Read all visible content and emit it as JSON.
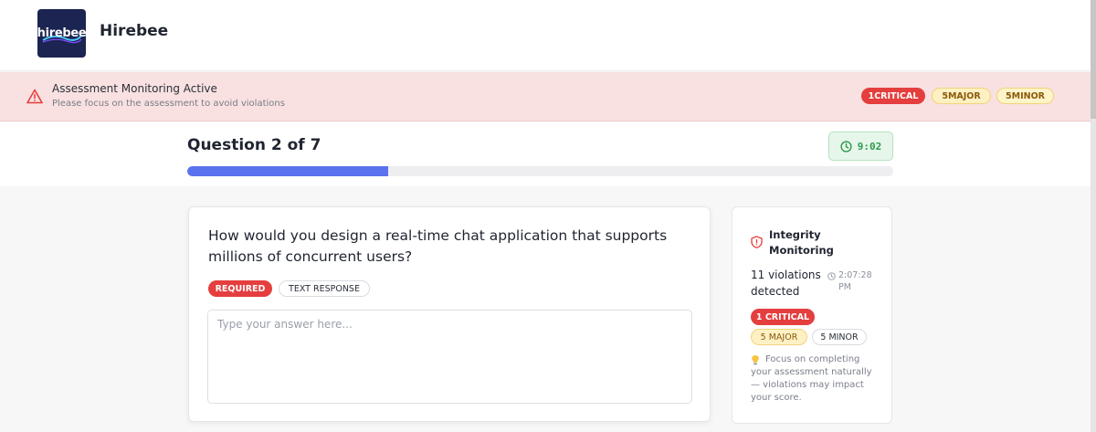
{
  "header": {
    "logo_text": "hirebee",
    "brand": "Hirebee"
  },
  "banner": {
    "title": "Assessment Monitoring Active",
    "subtitle": "Please focus on the assessment to avoid violations",
    "badges": {
      "critical": "1CRITICAL",
      "major": "5MAJOR",
      "minor": "5MINOR"
    }
  },
  "question_header": {
    "title": "Question 2 of 7",
    "timer": "9:02",
    "progress_fraction": 0.285
  },
  "question_card": {
    "question": "How would you design a real-time chat application that supports millions of concurrent users?",
    "tag_required": "REQUIRED",
    "tag_type": "TEXT RESPONSE",
    "answer_placeholder": "Type your answer here...",
    "answer_value": ""
  },
  "integrity": {
    "title": "Integrity Monitoring",
    "violations": "11 violations detected",
    "timestamp": "2:07:28 PM",
    "critical": "1 CRITICAL",
    "major": "5 MAJOR",
    "minor": "5 MINOR",
    "tip": "Focus on completing your assessment naturally — violations may impact your score."
  },
  "colors": {
    "accent": "#5b72ee",
    "critical": "#e53e3e",
    "major_bg": "#fdf1c4",
    "timer_green": "#2e9a4b",
    "banner_bg": "#f9e1e1",
    "logo_bg": "#1c2452"
  },
  "icons": {
    "banner": "warning-triangle-icon",
    "timer": "clock-icon",
    "integrity": "shield-alert-icon",
    "timestamp": "clock-small-icon",
    "tip": "lightbulb-icon"
  }
}
